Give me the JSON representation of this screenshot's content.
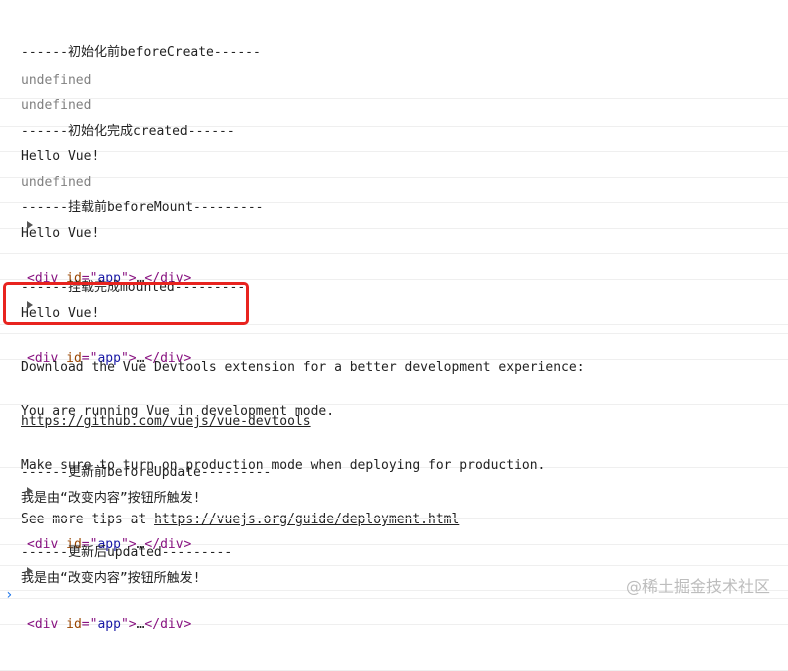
{
  "console": {
    "lines": [
      {
        "text": "------初始化前beforeCreate------"
      },
      {
        "text": "undefined"
      },
      {
        "text": "undefined"
      },
      {
        "text": "------初始化完成created------"
      },
      {
        "text": "Hello Vue!"
      },
      {
        "text": "undefined"
      },
      {
        "text": "------挂载前beforeMount---------"
      },
      {
        "text": "Hello Vue!"
      },
      {
        "tag_open": "<div ",
        "attr_name": "id",
        "attr_eq": "=\"",
        "attr_value": "app",
        "attr_close": "\">",
        "ellipsis": "…",
        "tag_close": "</div>"
      },
      {
        "text": "------挂载完成mounted---------"
      },
      {
        "text": "Hello Vue!"
      },
      {
        "tag_open": "<div ",
        "attr_name": "id",
        "attr_eq": "=\"",
        "attr_value": "app",
        "attr_close": "\">",
        "ellipsis": "…",
        "tag_close": "</div>"
      },
      {
        "line1": "Download the Vue Devtools extension for a better development experience:",
        "link": "https://github.com/vuejs/vue-devtools"
      },
      {
        "line1": "You are running Vue in development mode.",
        "line2": "Make sure to turn on production mode when deploying for production.",
        "line3_prefix": "See more tips at ",
        "link": "https://vuejs.org/guide/deployment.html"
      },
      {
        "text": "------更新前beforeUpdate---------"
      },
      {
        "text": "我是由“改变内容”按钮所触发!"
      },
      {
        "tag_open": "<div ",
        "attr_name": "id",
        "attr_eq": "=\"",
        "attr_value": "app",
        "attr_close": "\">",
        "ellipsis": "…",
        "tag_close": "</div>"
      },
      {
        "text": "------更新后updated---------"
      },
      {
        "text": "我是由“改变内容”按钮所触发!"
      },
      {
        "tag_open": "<div ",
        "attr_name": "id",
        "attr_eq": "=\"",
        "attr_value": "app",
        "attr_close": "\">",
        "ellipsis": "…",
        "tag_close": "</div>"
      }
    ],
    "prompt": "›"
  },
  "watermark": "@稀土掘金技术社区",
  "colors": {
    "highlight": "#e8231f",
    "undefined": "#808080",
    "tag": "#881280",
    "attr": "#994500",
    "value": "#1a1aa6",
    "prompt": "#1a73e8"
  },
  "icons": {
    "expand": "expand-triangle-icon"
  }
}
